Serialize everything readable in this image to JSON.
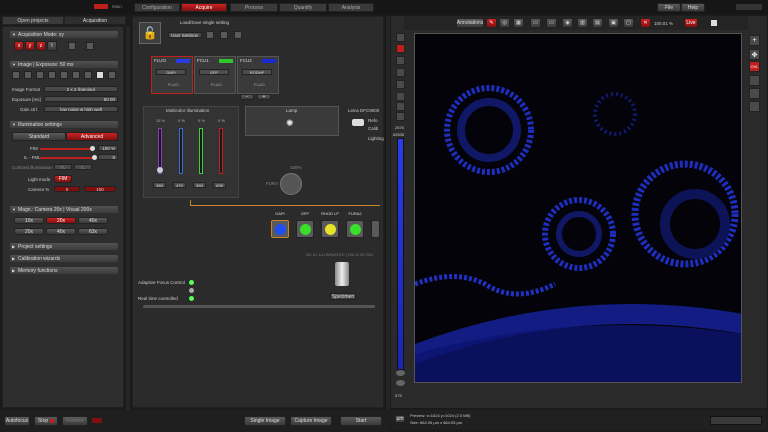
{
  "top_tabs": {
    "open_projects": "Open projects",
    "acquisition": "Acquisition"
  },
  "workflow_tabs": [
    "Configuration",
    "Acquire",
    "Process",
    "Quantify",
    "Analysis"
  ],
  "top_right": {
    "file": "File",
    "help": "Help"
  },
  "logo_text": "Main",
  "left": {
    "acq_mode": "Acquisition Mode: xy",
    "xyz_buttons": [
      "x",
      "y",
      "z",
      "t"
    ],
    "image_exposure": "Image | Exposure: 50 ms",
    "image_format_label": "Image Format",
    "image_format_value": "2 x 2 (binning)",
    "exposure_label": "Exposure [ms]",
    "exposure_value": "50.00",
    "gain_label": "Gain ctrl.",
    "gain_value": "low noise & high well",
    "illumination": "Illumination settings",
    "standard": "Standard",
    "advanced": "Advanced",
    "fim_label": "FIM",
    "fim_value": "100 %",
    "il_fim_label": "IL - FML",
    "il_fim_value": "6",
    "contrast_label": "Contrast illumination",
    "contrast_values": [
      "TL",
      "IL"
    ],
    "light_mode_label": "Light mode",
    "light_mode_value": "FIM",
    "camera_label": "Camera %",
    "camera_values": [
      "0",
      "100"
    ],
    "magn": "Magn.: Camera 20x | Visual 200x",
    "magn_buttons": [
      "10x",
      "20x",
      "40x",
      "20x",
      "40x",
      "63x"
    ],
    "project_settings": "Project settings",
    "calibration": "Calibration wizards",
    "memory": "Memory functions"
  },
  "center": {
    "load_save": "Load/Save single setting",
    "user_settings": "User Settings",
    "channels": [
      {
        "name": "FLUO",
        "dye": "DAPI",
        "sub": "FLUO",
        "color": "#2b3de0"
      },
      {
        "name": "FCU1",
        "dye": "GFP",
        "sub": "FLUO",
        "color": "#2ec52e"
      },
      {
        "name": "FCU2",
        "dye": "RODHP",
        "sub": "FLUO",
        "color": "#1b2ad0"
      }
    ],
    "multicolor": "Multicolor Illumination",
    "slider_pcts": [
      "15 %",
      "0 %",
      "0 %",
      "0 %"
    ],
    "slider_vals": [
      "385",
      "470",
      "550",
      "635"
    ],
    "lamp": "Lamp",
    "leica_camera": "Leica DFC9000",
    "leica_sub": [
      "Refo",
      "Calib",
      "Lighting"
    ],
    "fura2_label": "FURA",
    "fura2_pct": "100%",
    "filters": [
      "DAPI",
      "GFP",
      "RHOD LP",
      "FURA2",
      ""
    ],
    "filter_colors": [
      "#1e4ff0",
      "#3adf2a",
      "#e7e22a",
      "#3adf2a",
      "#555"
    ],
    "status_strip": "NC 81 ILLUMINATED  |  DSLN 40 OB1",
    "adaptive_focus": "Adaptive Focus Control",
    "realtime": "Real time controlled",
    "specimen": "Specimen"
  },
  "viewer": {
    "annotations": "Annotations",
    "zoom": "100.01 %",
    "live": "Live",
    "scale_top": "2575",
    "scale_mid": "65535",
    "scale_bottom": "575",
    "status_line1": "Preview: x=1024 y=1024 (2.0 MB)",
    "status_line2": "Size: 664.05 µm x 664.05 µm",
    "unit": "µm"
  },
  "bottom": {
    "autofocus": "Autofocus",
    "stop": "Stop",
    "frames": "Frames",
    "single_image": "Single Image",
    "capture_image": "Capture Image",
    "start": "Start"
  },
  "colors": {
    "accent_red": "#c0201c",
    "image_blue": "#2b3de8",
    "bg": "#1b1b1b"
  }
}
